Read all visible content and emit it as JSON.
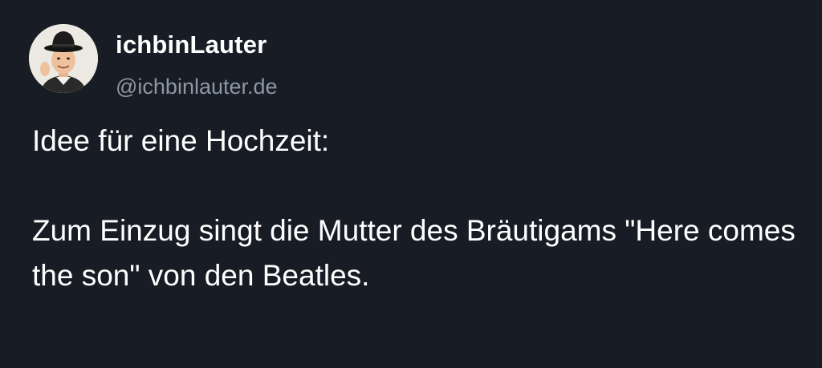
{
  "author": {
    "display_name": "ichbinLauter",
    "handle": "@ichbinlauter.de",
    "avatar_icon": "profile-photo-man-bowler-hat"
  },
  "post": {
    "line_1": "Idee für eine Hochzeit:",
    "paragraph_2": "Zum Einzug singt die Mutter des Bräutigams \"Here comes the son\" von den Beatles."
  },
  "colors": {
    "background": "#181c24",
    "text": "#ffffff",
    "handle": "#8b98a5"
  }
}
